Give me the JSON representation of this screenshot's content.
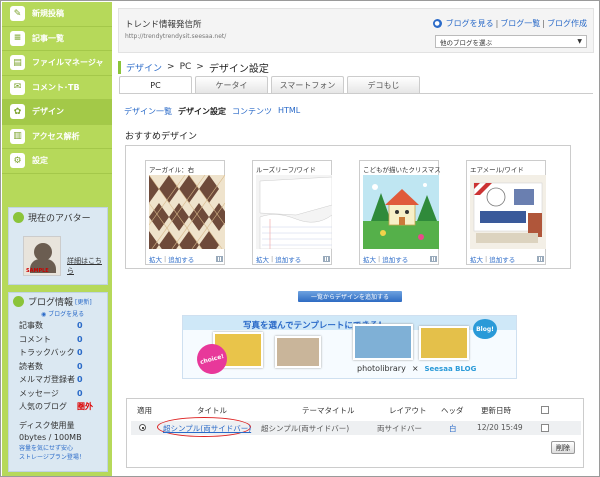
{
  "sidebar": {
    "nav": [
      {
        "label": "新規投稿",
        "icon": "pencil-icon",
        "glyph": "✎"
      },
      {
        "label": "記事一覧",
        "icon": "document-list-icon",
        "glyph": "≡"
      },
      {
        "label": "ファイルマネージャ",
        "icon": "clipboard-icon",
        "glyph": "▤"
      },
      {
        "label": "コメント･TB",
        "icon": "comment-icon",
        "glyph": "✉"
      },
      {
        "label": "デザイン",
        "icon": "palette-icon",
        "glyph": "✿"
      },
      {
        "label": "アクセス解析",
        "icon": "bar-chart-icon",
        "glyph": "▥"
      },
      {
        "label": "設定",
        "icon": "settings-icon",
        "glyph": "⚙"
      }
    ],
    "avatar": {
      "heading": "現在のアバター",
      "sample_label": "SAMPLE",
      "link": "詳細はこちら"
    },
    "blog_info": {
      "heading": "ブログ情報",
      "update_link": "[更新]",
      "view_link": "ブログを見る",
      "stats": [
        {
          "key": "記事数",
          "value": "0"
        },
        {
          "key": "コメント",
          "value": "0"
        },
        {
          "key": "トラックバック",
          "value": "0"
        },
        {
          "key": "読者数",
          "value": "0"
        },
        {
          "key": "メルマガ登録者",
          "value": "0"
        },
        {
          "key": "メッセージ",
          "value": "0"
        },
        {
          "key": "人気のブログ",
          "value": "圏外"
        }
      ],
      "disk_label": "ディスク使用量",
      "disk_value": "0bytes / 100MB",
      "disk_link1": "容量を気にせず安心",
      "disk_link2": "ストレージプラン登場！"
    }
  },
  "header": {
    "blog_title": "トレンド情報発信所",
    "blog_url": "http://trendytrendysit.seesaa.net/",
    "link_view": "ブログを見る",
    "link_list": "ブログ一覧",
    "link_create": "ブログ作成",
    "select_value": "他のブログを選ぶ"
  },
  "breadcrumb": {
    "design": "デザイン",
    "pc": "PC",
    "current": "デザイン設定"
  },
  "tabs": [
    "PC",
    "ケータイ",
    "スマートフォン",
    "デコもじ"
  ],
  "subnav": {
    "list": "デザイン一覧",
    "setting": "デザイン設定",
    "contents": "コンテンツ",
    "html": "HTML"
  },
  "recommended": {
    "title": "おすすめデザイン",
    "cards": [
      {
        "name": "アーガイル：右",
        "expand": "拡大",
        "add": "追加する"
      },
      {
        "name": "ルーズリーフ/ワイド",
        "expand": "拡大",
        "add": "追加する"
      },
      {
        "name": "こどもが描いたクリスマス",
        "expand": "拡大",
        "add": "追加する"
      },
      {
        "name": "エアメール/ワイド",
        "expand": "拡大",
        "add": "追加する"
      }
    ],
    "add_button": "一覧からデザインを追加する"
  },
  "banner": {
    "headline": "写真を選んでテンプレートにできる!",
    "choice": "choice!",
    "blog": "Blog!",
    "brand1": "photolibrary",
    "times": "×",
    "brand2": "Seesaa BLOG"
  },
  "table": {
    "headers": {
      "apply": "適用",
      "title": "タイトル",
      "theme": "テーマタイトル",
      "layout": "レイアウト",
      "header": "ヘッダ",
      "updated": "更新日時"
    },
    "row": {
      "title": "超シンプル(両サイドバー)",
      "theme": "超シンプル(両サイドバー)",
      "layout": "両サイドバー",
      "header": "白",
      "updated": "12/20 15:49"
    },
    "delete_button": "削除"
  },
  "colors": {
    "sidebar": "#b6d95a",
    "link": "#2a6ac8",
    "accent_green": "#8bc43a",
    "highlight_red": "#d22222"
  }
}
